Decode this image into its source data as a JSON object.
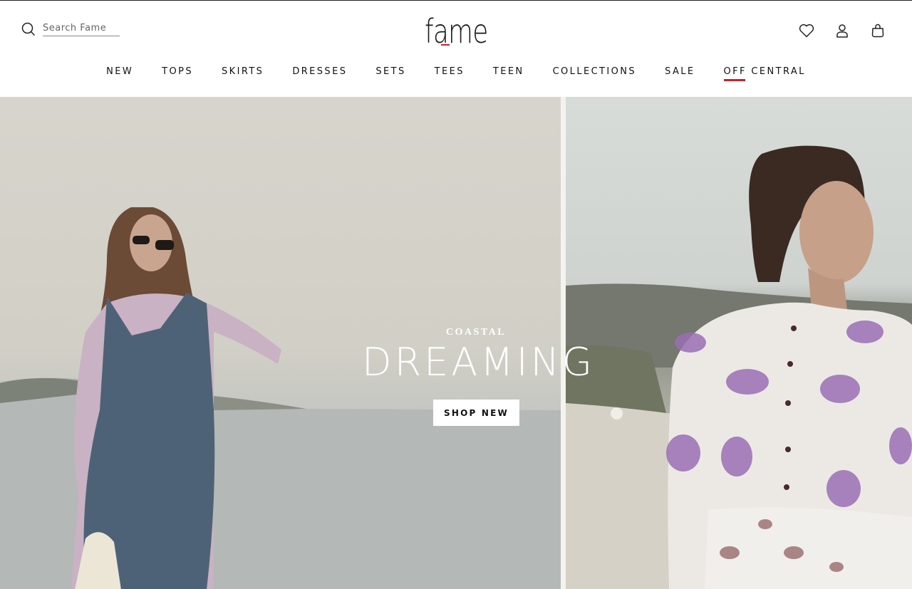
{
  "header": {
    "search": {
      "placeholder": "Search Fame",
      "icon": "search-icon"
    },
    "logo": "fame",
    "icons": [
      "heart-icon",
      "account-icon",
      "bag-icon"
    ],
    "accent_color": "#c8202b"
  },
  "nav": {
    "items": [
      {
        "label": "NEW"
      },
      {
        "label": "TOPS"
      },
      {
        "label": "SKIRTS"
      },
      {
        "label": "DRESSES"
      },
      {
        "label": "SETS"
      },
      {
        "label": "TEES"
      },
      {
        "label": "TEEN"
      },
      {
        "label": "COLLECTIONS"
      },
      {
        "label": "SALE"
      }
    ],
    "off_central": {
      "prefix": "OFF",
      "suffix": " CENTRAL"
    }
  },
  "hero": {
    "eyebrow": "COASTAL",
    "headline": "DREAMING",
    "cta": "SHOP NEW"
  }
}
